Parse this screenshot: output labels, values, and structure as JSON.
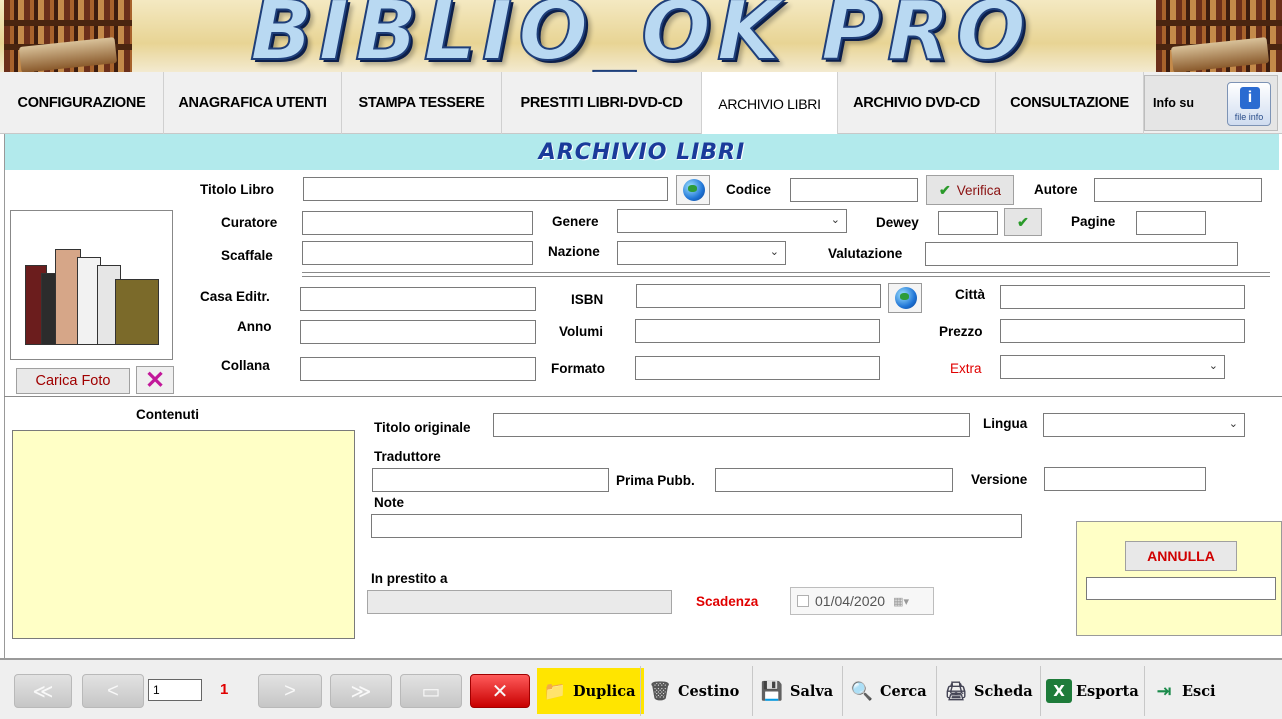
{
  "banner": {
    "title": "BIBLIO_OK PRO"
  },
  "tabs": [
    {
      "label": "CONFIGURAZIONE"
    },
    {
      "label": "ANAGRAFICA UTENTI"
    },
    {
      "label": "STAMPA TESSERE"
    },
    {
      "label": "PRESTITI LIBRI-DVD-CD"
    },
    {
      "label": "ARCHIVIO LIBRI"
    },
    {
      "label": "ARCHIVIO DVD-CD"
    },
    {
      "label": "CONSULTAZIONE"
    }
  ],
  "info": {
    "label": "Info su",
    "icon_text": "file info",
    "icon_letter": "i"
  },
  "section_title": "ARCHIVIO LIBRI",
  "form": {
    "titolo_libro": "Titolo Libro",
    "codice": "Codice",
    "verifica": "Verifica",
    "autore": "Autore",
    "curatore": "Curatore",
    "genere": "Genere",
    "dewey": "Dewey",
    "pagine": "Pagine",
    "scaffale": "Scaffale",
    "nazione": "Nazione",
    "valutazione": "Valutazione",
    "casa_editrice": "Casa Editr.",
    "isbn": "ISBN",
    "citta": "Città",
    "anno": "Anno",
    "volumi": "Volumi",
    "prezzo": "Prezzo",
    "collana": "Collana",
    "formato": "Formato",
    "extra": "Extra",
    "contenuti": "Contenuti",
    "titolo_originale": "Titolo originale",
    "lingua": "Lingua",
    "traduttore": "Traduttore",
    "prima_pubb": "Prima Pubb.",
    "versione": "Versione",
    "note": "Note",
    "in_prestito_a": "In prestito a",
    "scadenza": "Scadenza",
    "scadenza_value": "01/04/2020"
  },
  "photo": {
    "carica_foto": "Carica Foto"
  },
  "annulla": "ANNULLA",
  "navigation": {
    "page_value": "1",
    "page_count": "1"
  },
  "toolbar": {
    "duplica": "Duplica",
    "cestino": "Cestino",
    "salva": "Salva",
    "cerca": "Cerca",
    "scheda": "Scheda",
    "esporta": "Esporta",
    "esci": "Esci"
  },
  "colors": {
    "title_bar": "#b2eaec",
    "yellow_area": "#ffffc6",
    "duplica_bg": "#ffe500",
    "red_text": "#e00000"
  }
}
